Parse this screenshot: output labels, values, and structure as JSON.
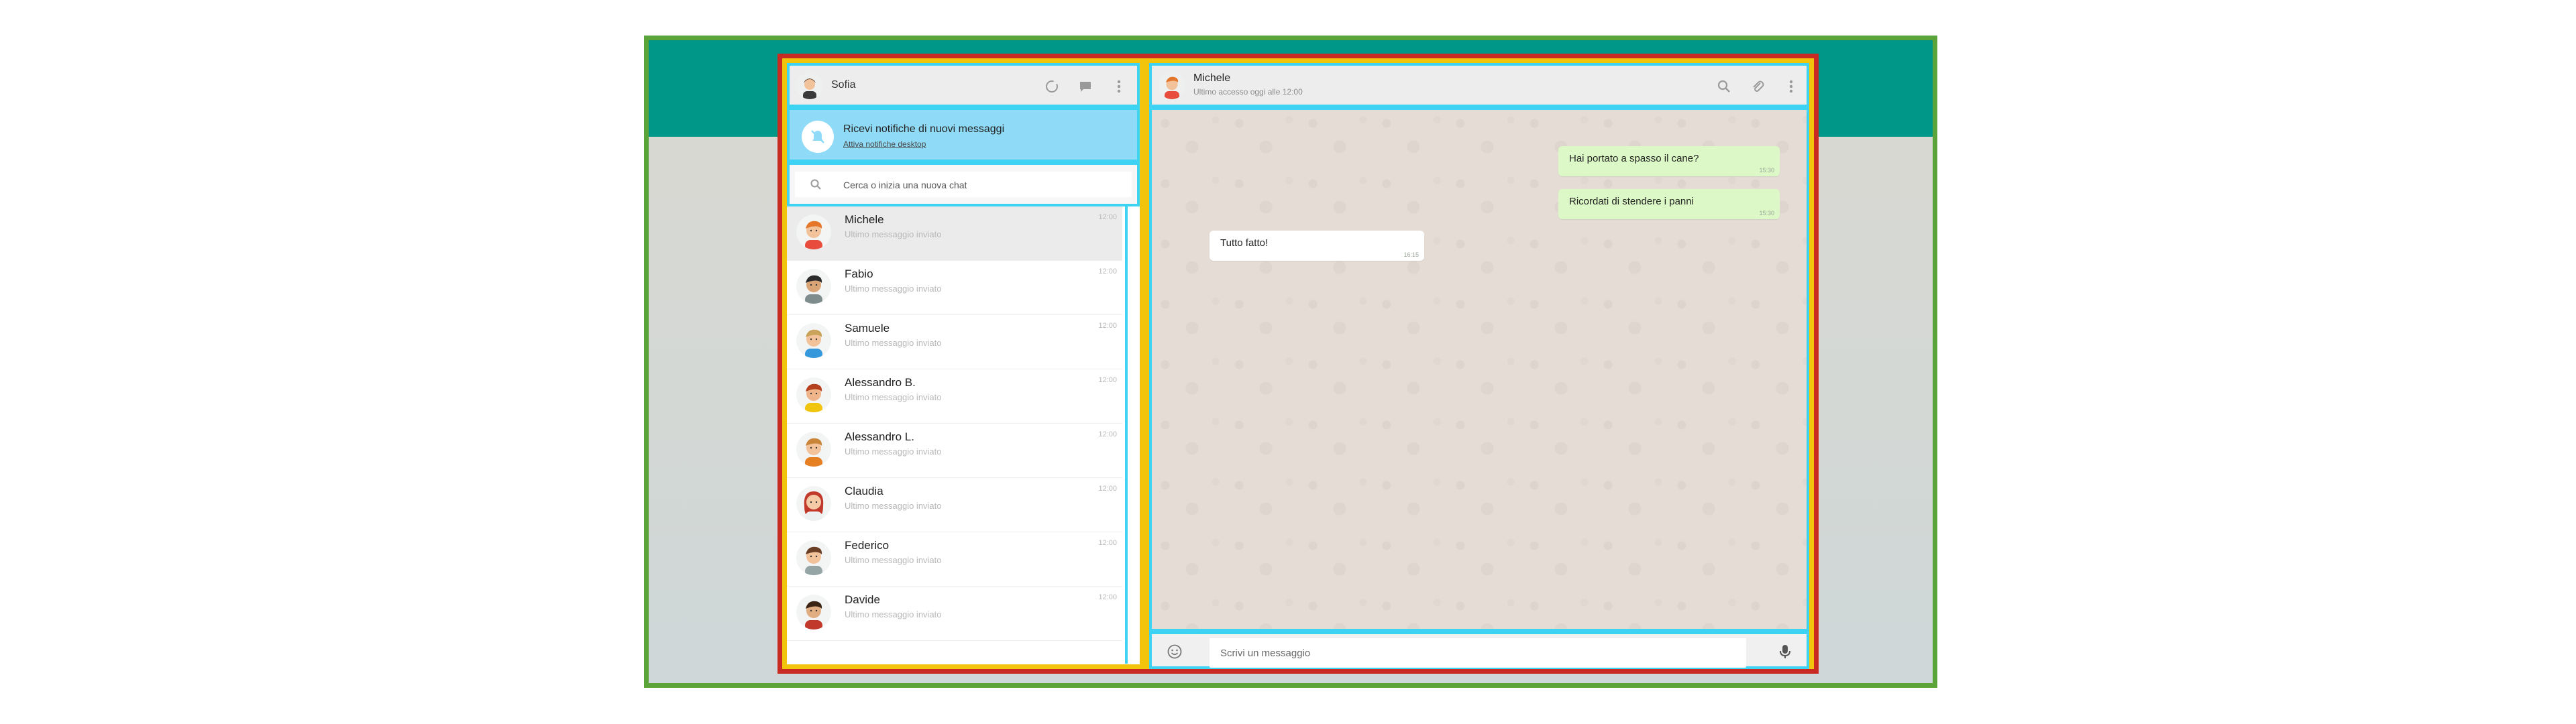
{
  "colors": {
    "accent_teal": "#009688",
    "notif_bg": "#8fdbf7",
    "outgoing_bubble": "#dcf8c6",
    "incoming_bubble": "#ffffff",
    "chat_bg": "#e5ddd5"
  },
  "me": {
    "name": "Sofia",
    "avatar_icon": "female-avatar-icon"
  },
  "header_icons": [
    "status-icon",
    "new-chat-icon",
    "menu-dots-icon"
  ],
  "notification": {
    "title": "Ricevi notifiche di nuovi messaggi",
    "link": "Attiva notifiche desktop"
  },
  "search": {
    "placeholder": "Cerca o inizia una nuova chat"
  },
  "contacts": [
    {
      "name": "Michele",
      "last": "Ultimo messaggio inviato",
      "time": "12:00",
      "skin": "#f2c29b",
      "hair": "#e4762b",
      "shirt": "#e74c3c"
    },
    {
      "name": "Fabio",
      "last": "Ultimo messaggio inviato",
      "time": "12:00",
      "skin": "#d9a577",
      "hair": "#2b2b2b",
      "shirt": "#7f8c8d"
    },
    {
      "name": "Samuele",
      "last": "Ultimo messaggio inviato",
      "time": "12:00",
      "skin": "#f2c29b",
      "hair": "#c9a35a",
      "shirt": "#3498db"
    },
    {
      "name": "Alessandro B.",
      "last": "Ultimo messaggio inviato",
      "time": "12:00",
      "skin": "#f0b48a",
      "hair": "#b5401e",
      "shirt": "#f1c40f"
    },
    {
      "name": "Alessandro L.",
      "last": "Ultimo messaggio inviato",
      "time": "12:00",
      "skin": "#f2c29b",
      "hair": "#c9863a",
      "shirt": "#e67e22"
    },
    {
      "name": "Claudia",
      "last": "Ultimo messaggio inviato",
      "time": "12:00",
      "skin": "#f5cba7",
      "hair": "#c0392b",
      "shirt": "#ecf0f1"
    },
    {
      "name": "Federico",
      "last": "Ultimo messaggio inviato",
      "time": "12:00",
      "skin": "#f2c29b",
      "hair": "#6b3e26",
      "shirt": "#95a5a6"
    },
    {
      "name": "Davide",
      "last": "Ultimo messaggio inviato",
      "time": "12:00",
      "skin": "#e0ac82",
      "hair": "#3b2314",
      "shirt": "#c0392b"
    }
  ],
  "active_chat": {
    "name": "Michele",
    "status": "Ultimo accesso oggi alle 12:00",
    "icons": [
      "search-icon",
      "paperclip-icon",
      "menu-dots-icon"
    ]
  },
  "messages": [
    {
      "dir": "out",
      "text": "Hai portato a spasso il cane?",
      "time": "15:30"
    },
    {
      "dir": "out",
      "text": "Ricordati di stendere i panni",
      "time": "15:30"
    },
    {
      "dir": "in",
      "text": "Tutto fatto!",
      "time": "16:15"
    }
  ],
  "composer": {
    "placeholder": "Scrivi un messaggio"
  }
}
